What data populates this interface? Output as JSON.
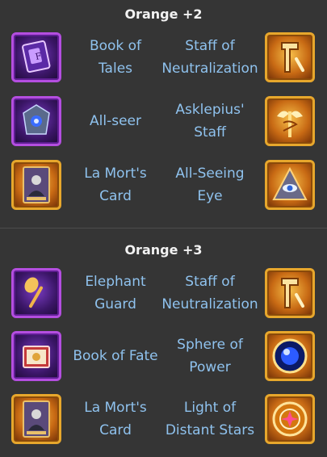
{
  "sections": [
    {
      "title": "Orange +2",
      "rows": [
        {
          "left_name": "Book of\nTales",
          "right_name": "Staff of\nNeutralization",
          "left_icon": "book-of-tales-icon",
          "right_icon": "staff-of-neutralization-icon"
        },
        {
          "left_name": "All-seer",
          "right_name": "Asklepius'\nStaff",
          "left_icon": "all-seer-icon",
          "right_icon": "asklepius-staff-icon"
        },
        {
          "left_name": "La Mort's\nCard",
          "right_name": "All-Seeing\nEye",
          "left_icon": "la-morts-card-icon",
          "right_icon": "all-seeing-eye-icon"
        }
      ]
    },
    {
      "title": "Orange +3",
      "rows": [
        {
          "left_name": "Elephant\nGuard",
          "right_name": "Staff of\nNeutralization",
          "left_icon": "elephant-guard-icon",
          "right_icon": "staff-of-neutralization-icon"
        },
        {
          "left_name": "Book of Fate",
          "right_name": "Sphere of\nPower",
          "left_icon": "book-of-fate-icon",
          "right_icon": "sphere-of-power-icon"
        },
        {
          "left_name": "La Mort's\nCard",
          "right_name": "Light of\nDistant Stars",
          "left_icon": "la-morts-card-icon",
          "right_icon": "light-of-distant-stars-icon"
        }
      ]
    }
  ],
  "colors": {
    "background": "#353535",
    "title": "#f2f2f2",
    "item_name": "#8fc2ee",
    "purple_frame": "#b44ee0",
    "orange_frame": "#e7a72c"
  }
}
